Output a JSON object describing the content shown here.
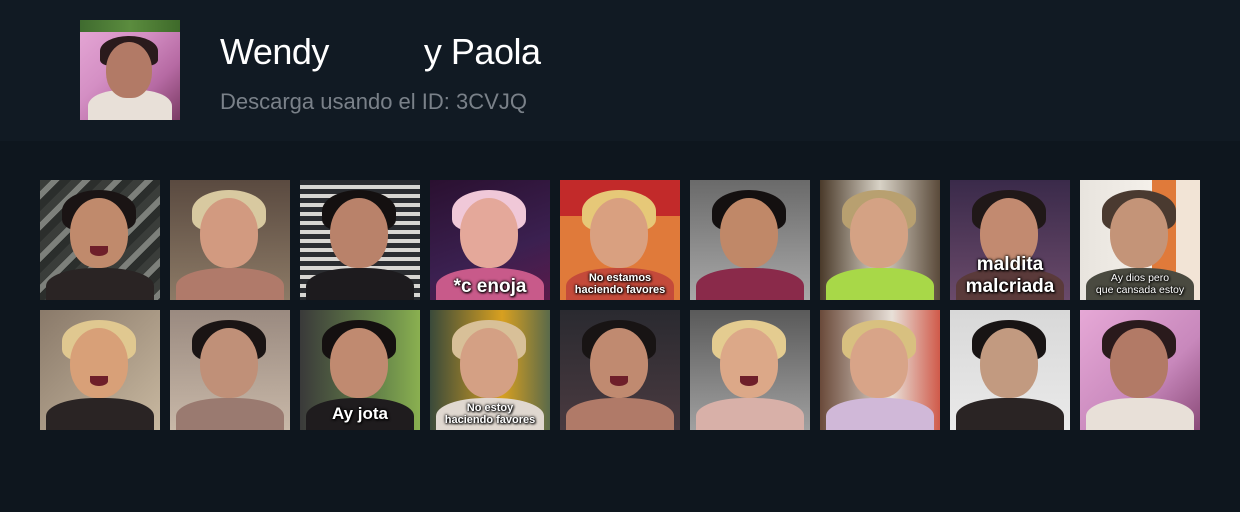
{
  "pack": {
    "title": "Wendy          y Paola",
    "subtitle": "Descarga usando el ID: 3CVJQ"
  },
  "stickers": [
    {
      "caption": ""
    },
    {
      "caption": ""
    },
    {
      "caption": ""
    },
    {
      "caption": "*c enoja"
    },
    {
      "caption": "No estamos\nhaciendo favores"
    },
    {
      "caption": ""
    },
    {
      "caption": ""
    },
    {
      "caption": "maldita\nmalcriada"
    },
    {
      "caption": "Ay dios pero\nque cansada estoy"
    },
    {
      "caption": ""
    },
    {
      "caption": ""
    },
    {
      "caption": "Ay jota"
    },
    {
      "caption": "No estoy\nhaciendo favores"
    },
    {
      "caption": ""
    },
    {
      "caption": ""
    },
    {
      "caption": ""
    },
    {
      "caption": ""
    },
    {
      "caption": ""
    }
  ],
  "colors": {
    "header_bg": "#111a23",
    "page_bg": "#0e161e",
    "title_text": "#ffffff",
    "subtitle_text": "#7a8189"
  }
}
